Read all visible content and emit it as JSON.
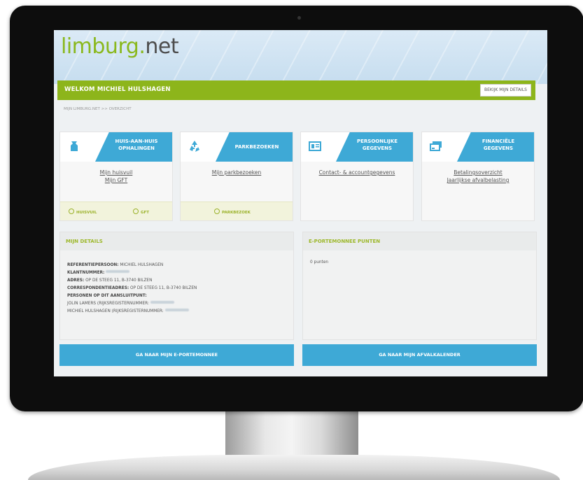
{
  "brand": {
    "logo_main": "limburg",
    "logo_dot": ".",
    "logo_suffix": "net"
  },
  "welcome": {
    "title": "WELKOM MICHIEL HULSHAGEN",
    "button": "BEKIJK MIJN DETAILS"
  },
  "breadcrumb": "MIJN LIMBURG.NET  >>  OVERZICHT",
  "tiles": [
    {
      "title_line1": "HUIS-AAN-HUIS",
      "title_line2": "OPHALINGEN",
      "icon": "trash-bag-icon",
      "links": [
        "Mijn huisvuil",
        "Mijn GFT"
      ],
      "foot": [
        "HUISVUIL",
        "GFT"
      ]
    },
    {
      "title_line1": "PARKBEZOEKEN",
      "icon": "recycle-icon",
      "links": [
        "Mijn parkbezoeken"
      ],
      "foot": [
        "PARKBEZOEK"
      ]
    },
    {
      "title_line1": "PERSOONLIJKE",
      "title_line2": "GEGEVENS",
      "icon": "id-card-icon",
      "links": [
        "Contact- & accountgegevens"
      ]
    },
    {
      "title_line1": "FINANCIËLE",
      "title_line2": "GEGEVENS",
      "icon": "credit-card-icon",
      "links": [
        "Betalingsoverzicht",
        "Jaarlijkse afvalbelasting"
      ]
    }
  ],
  "details": {
    "title": "MIJN DETAILS",
    "ref_label": "REFERENTIEPERSOON:",
    "ref_value": "MICHIEL HULSHAGEN",
    "client_label": "KLANTNUMMER:",
    "address_label": "ADRES:",
    "address_value": "OP DE STEEG 11, B-3740 BILZEN",
    "corr_label": "CORRESPONDENTIEADRES:",
    "corr_value": "OP DE STEEG 11, B-3740 BILZEN",
    "persons_label": "PERSONEN OP DIT AANSLUITPUNT:",
    "person1": "JOLIN LAMERS (RIJKSREGISTERNUMMER:",
    "person2": "MICHIEL HULSHAGEN (RIJKSREGISTERNUMMER:"
  },
  "wallet": {
    "title": "E-PORTEMONNEE PUNTEN",
    "points": "0 punten"
  },
  "cta": {
    "wallet": "GA NAAR MIJN E-PORTEMONNEE",
    "calendar": "GA NAAR MIJN AFVALKALENDER"
  },
  "colors": {
    "green": "#8db51b",
    "blue": "#3ea9d6",
    "dark": "#0d0d0d"
  }
}
